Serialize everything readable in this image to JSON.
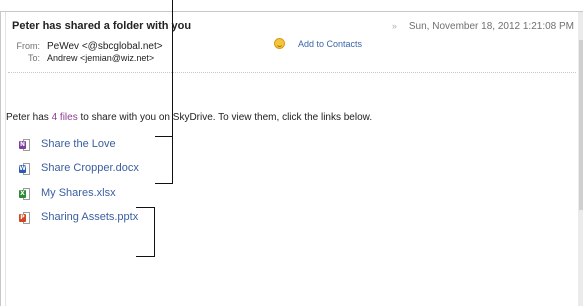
{
  "email": {
    "subject": "Peter has shared a folder with you",
    "date": "Sun, November 18, 2012 1:21:08 PM",
    "from_label": "From:",
    "from_value": "PeWev <@sbcglobal.net>",
    "to_label": "To:",
    "to_value": "Andrew <jemian@wiz.net>",
    "add_contacts": "Add to Contacts"
  },
  "body": {
    "intro_before": "Peter has ",
    "intro_count": "4 files",
    "intro_after": " to share with you on SkyDrive. To view them, click the links below.",
    "files": [
      {
        "name": "Share the Love",
        "icon": "onenote-icon",
        "letter": "N",
        "color": "#7b3f9e"
      },
      {
        "name": "Share Cropper.docx",
        "icon": "word-icon",
        "letter": "W",
        "color": "#2b5bb5"
      },
      {
        "name": "My Shares.xlsx",
        "icon": "excel-icon",
        "letter": "X",
        "color": "#2f8a36"
      },
      {
        "name": "Sharing Assets.pptx",
        "icon": "powerpoint-icon",
        "letter": "P",
        "color": "#d24726"
      }
    ]
  }
}
